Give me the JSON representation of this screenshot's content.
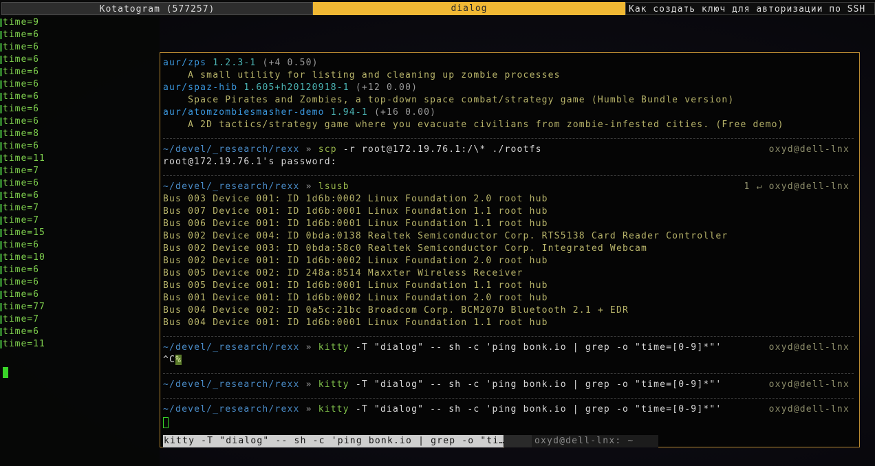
{
  "tabs": [
    {
      "label": "Kotatogram (577257)"
    },
    {
      "label": "dialog"
    },
    {
      "label": "Как создать ключ для авторизации по SSH"
    }
  ],
  "left_terminal": {
    "lines": [
      "time=9",
      "time=6",
      "time=6",
      "time=6",
      "time=6",
      "time=6",
      "time=6",
      "time=6",
      "time=6",
      "time=8",
      "time=6",
      "time=11",
      "time=7",
      "time=6",
      "time=6",
      "time=7",
      "time=7",
      "time=15",
      "time=6",
      "time=10",
      "time=6",
      "time=6",
      "time=6",
      "time=77",
      "time=7",
      "time=6",
      "time=11"
    ]
  },
  "terminal": {
    "packages": [
      {
        "repo": "aur/",
        "name": "zps",
        "version": "1.2.3-1",
        "stats": "(+4 0.50)",
        "desc": "    A small utility for listing and cleaning up zombie processes"
      },
      {
        "repo": "aur/",
        "name": "spaz-hib",
        "version": "1.605+h20120918-1",
        "stats": "(+12 0.00)",
        "desc": "    Space Pirates and Zombies, a top-down space combat/strategy game (Humble Bundle version)"
      },
      {
        "repo": "aur/",
        "name": "atomzombiesmasher-demo",
        "version": "1.94-1",
        "stats": "(+16 0.00)",
        "desc": "    A 2D tactics/strategy game where you evacuate civilians from zombie-infested cities. (Free demo)"
      }
    ],
    "prompt_path": "~/devel/_research/rexx",
    "prompt_sym": " » ",
    "host": "oxyd@dell-lnx",
    "scp": {
      "cmd": "scp",
      "args": " -r root@172.19.76.1:/\\* ./rootfs",
      "output": "root@172.19.76.1's password:"
    },
    "lsusb": {
      "cmd": "lsusb",
      "status": "1 ↵ ",
      "lines": [
        "Bus 003 Device 001: ID 1d6b:0002 Linux Foundation 2.0 root hub",
        "Bus 007 Device 001: ID 1d6b:0001 Linux Foundation 1.1 root hub",
        "Bus 006 Device 001: ID 1d6b:0001 Linux Foundation 1.1 root hub",
        "Bus 002 Device 004: ID 0bda:0138 Realtek Semiconductor Corp. RTS5138 Card Reader Controller",
        "Bus 002 Device 003: ID 0bda:58c0 Realtek Semiconductor Corp. Integrated Webcam",
        "Bus 002 Device 001: ID 1d6b:0002 Linux Foundation 2.0 root hub",
        "Bus 005 Device 002: ID 248a:8514 Maxxter Wireless Receiver",
        "Bus 005 Device 001: ID 1d6b:0001 Linux Foundation 1.1 root hub",
        "Bus 001 Device 001: ID 1d6b:0002 Linux Foundation 2.0 root hub",
        "Bus 004 Device 002: ID 0a5c:21bc Broadcom Corp. BCM2070 Bluetooth 2.1 + EDR",
        "Bus 004 Device 001: ID 1d6b:0001 Linux Foundation 1.1 root hub"
      ]
    },
    "kitty": {
      "cmd": "kitty",
      "args": " -T \"dialog\" -- sh -c 'ping bonk.io | grep -o \"time=[0-9]*\"'"
    },
    "interrupt": {
      "text": "^C",
      "hl": "%"
    },
    "statusbar": {
      "cmd": "kitty -T \"dialog\" -- sh -c 'ping bonk.io | grep -o \"ti…",
      "host": "oxyd@dell-lnx: ~"
    }
  }
}
